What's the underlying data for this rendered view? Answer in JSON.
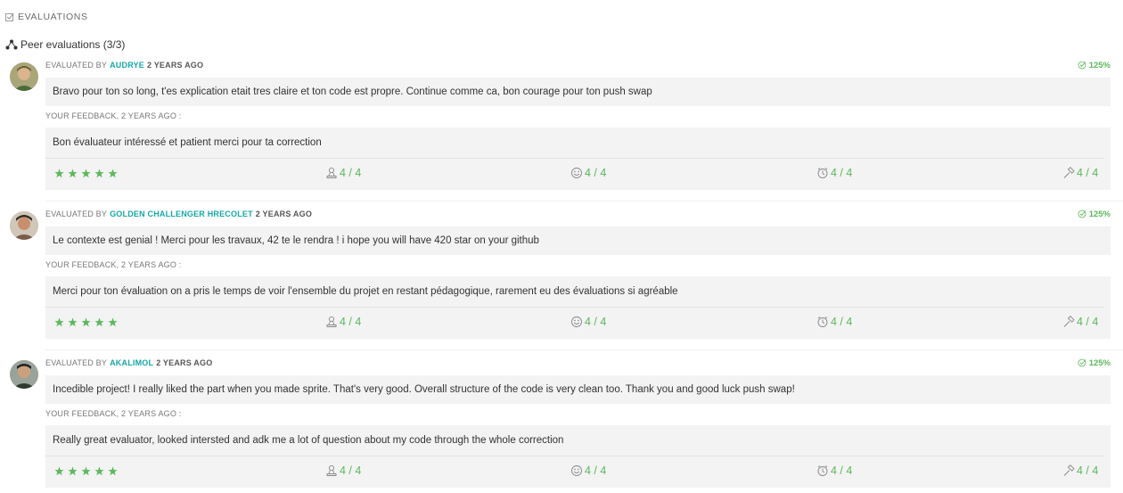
{
  "section": {
    "title": "EVALUATIONS",
    "icon": "checkbox-icon"
  },
  "peer": {
    "title": "Peer evaluations (3/3)",
    "icon": "network-icon"
  },
  "labels": {
    "evaluated_by": "EVALUATED BY",
    "your_feedback": "YOUR FEEDBACK, 2 YEARS AGO :"
  },
  "colors": {
    "accent": "#16a7a6",
    "success": "#5cb85c",
    "box_bg": "#f3f3f3"
  },
  "evaluations": [
    {
      "user": "AUDRYE",
      "ago": "2 YEARS AGO",
      "score": "125%",
      "comment": "Bravo pour ton so long, t'es explication etait tres claire et ton code est propre. Continue comme ca, bon courage pour ton push swap",
      "feedback": "Bon évaluateur intéressé et patient merci pour ta correction",
      "rating": 5,
      "metrics": {
        "punctuality": "4 / 4",
        "friendliness": "4 / 4",
        "timing": "4 / 4",
        "interest": "4 / 4"
      }
    },
    {
      "user": "GOLDEN CHALLENGER HRECOLET",
      "ago": "2 YEARS AGO",
      "score": "125%",
      "comment": "Le contexte est genial ! Merci pour les travaux, 42 te le rendra ! i hope you will have 420 star on your github",
      "feedback": "Merci pour ton évaluation on a pris le temps de voir l'ensemble du projet en restant pédagogique, rarement eu des évaluations si agréable",
      "rating": 5,
      "metrics": {
        "punctuality": "4 / 4",
        "friendliness": "4 / 4",
        "timing": "4 / 4",
        "interest": "4 / 4"
      }
    },
    {
      "user": "AKALIMOL",
      "ago": "2 YEARS AGO",
      "score": "125%",
      "comment": "Incedible project! I really liked the part when you made sprite. That's very good. Overall structure of the code is very clean too. Thank you and good luck push swap!",
      "feedback": "Really great evaluator, looked intersted and adk me a lot of question about my code through the whole correction",
      "rating": 5,
      "metrics": {
        "punctuality": "4 / 4",
        "friendliness": "4 / 4",
        "timing": "4 / 4",
        "interest": "4 / 4"
      }
    }
  ]
}
